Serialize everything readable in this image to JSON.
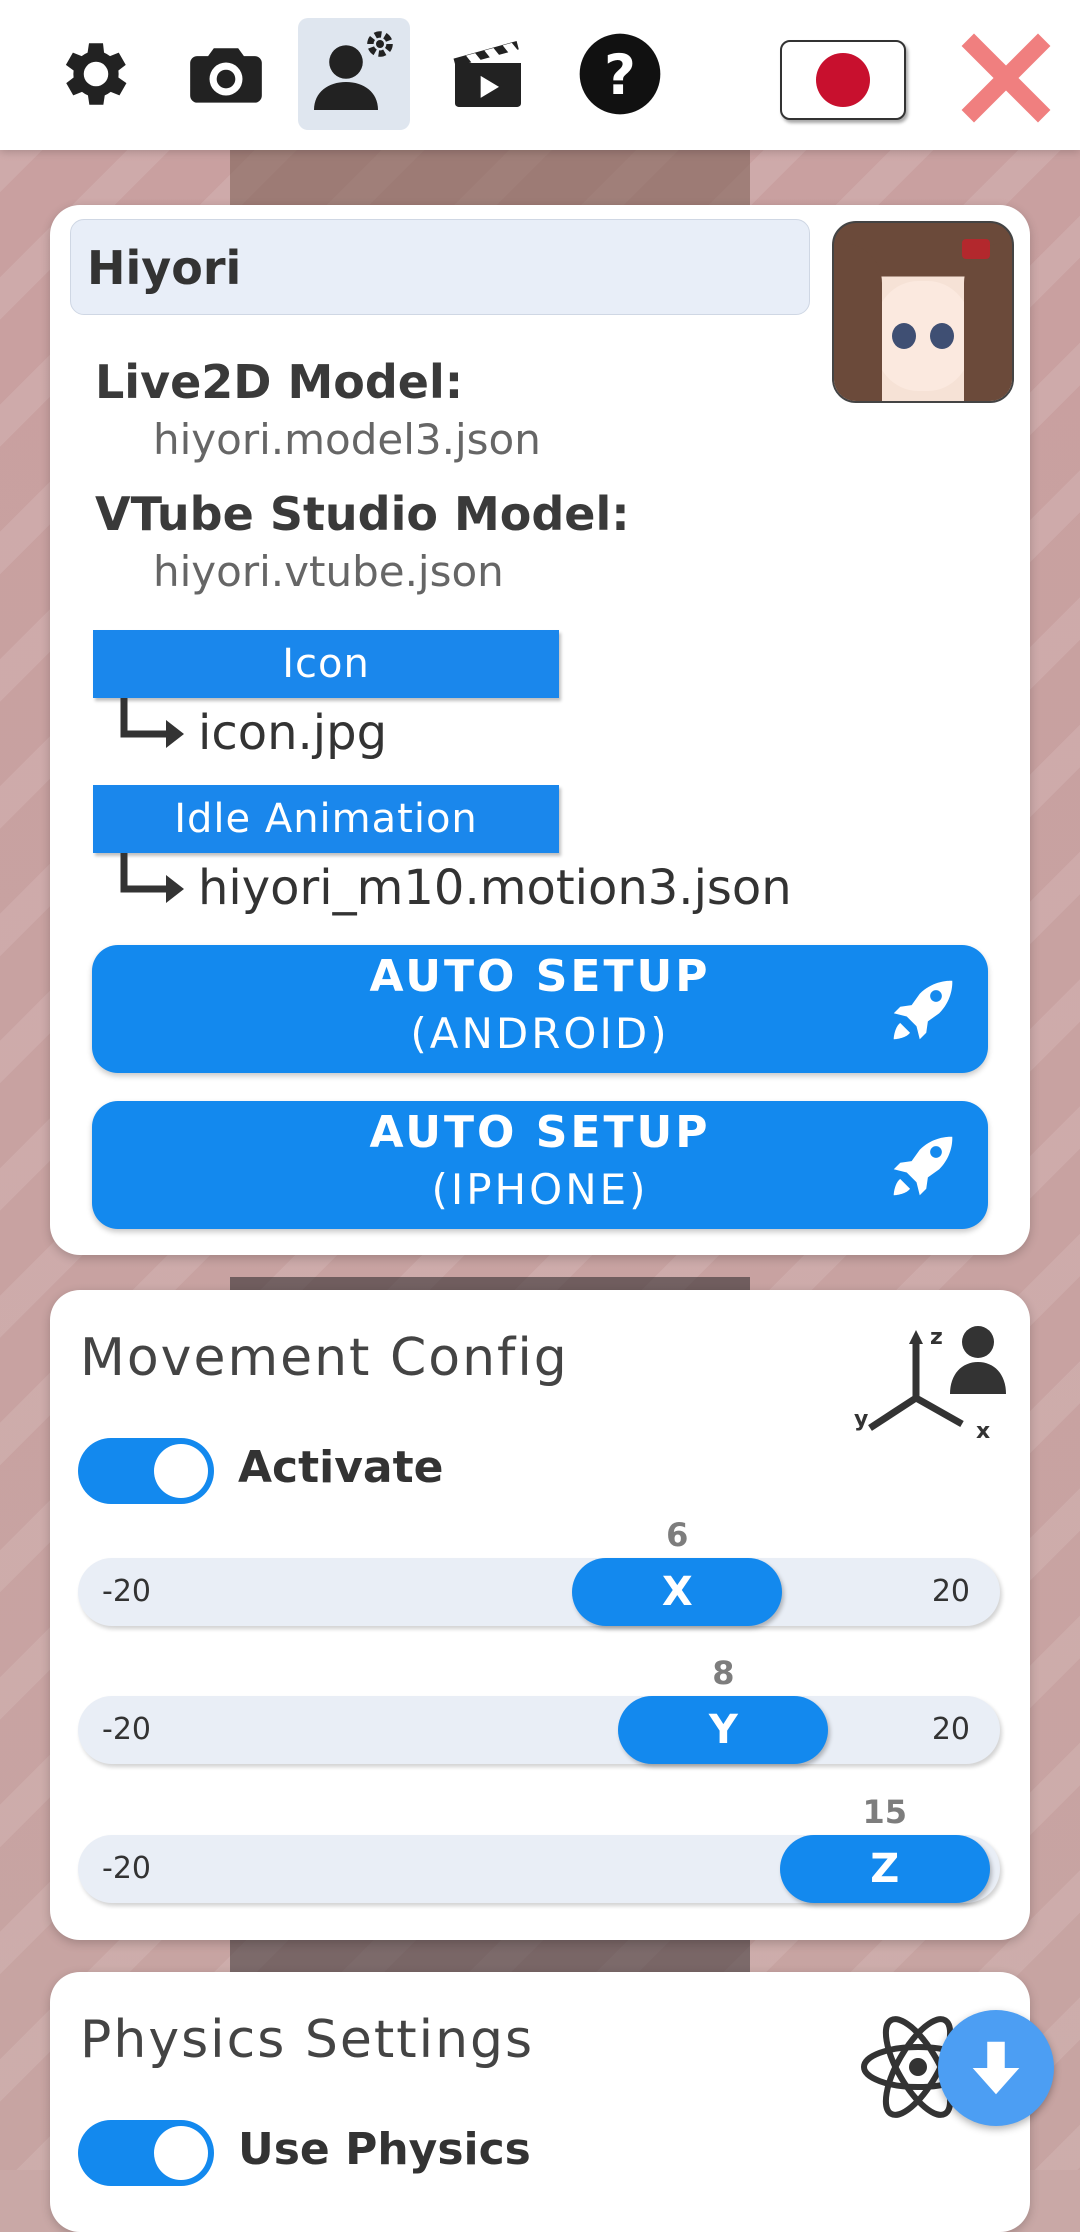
{
  "toolbar": {
    "icons": [
      "gear-icon",
      "camera-icon",
      "model-settings-icon",
      "clapperboard-icon",
      "help-icon"
    ],
    "active_index": 2,
    "language_flag": "japan-flag-icon",
    "close": "close-icon"
  },
  "model": {
    "name": "Hiyori",
    "live2d_label": "Live2D Model:",
    "live2d_value": "hiyori.model3.json",
    "vtube_label": "VTube Studio Model:",
    "vtube_value": "hiyori.vtube.json",
    "icon_button": "Icon",
    "icon_value": "icon.jpg",
    "idle_button": "Idle Animation",
    "idle_value": "hiyori_m10.motion3.json",
    "auto_android_line1": "AUTO SETUP",
    "auto_android_line2": "(ANDROID)",
    "auto_iphone_line1": "AUTO SETUP",
    "auto_iphone_line2": "(IPHONE)"
  },
  "movement": {
    "title": "Movement Config",
    "activate_label": "Activate",
    "activate_on": true,
    "sliders": [
      {
        "axis": "X",
        "value": "6",
        "min": "-20",
        "max": "20"
      },
      {
        "axis": "Y",
        "value": "8",
        "min": "-20",
        "max": "20"
      },
      {
        "axis": "Z",
        "value": "15",
        "min": "-20",
        "max": "20"
      }
    ]
  },
  "physics": {
    "title": "Physics Settings",
    "use_physics_label": "Use Physics",
    "use_physics_on": true
  },
  "colors": {
    "accent": "#1389ee",
    "close": "#f07f7f",
    "field_bg": "#e8eef8"
  }
}
